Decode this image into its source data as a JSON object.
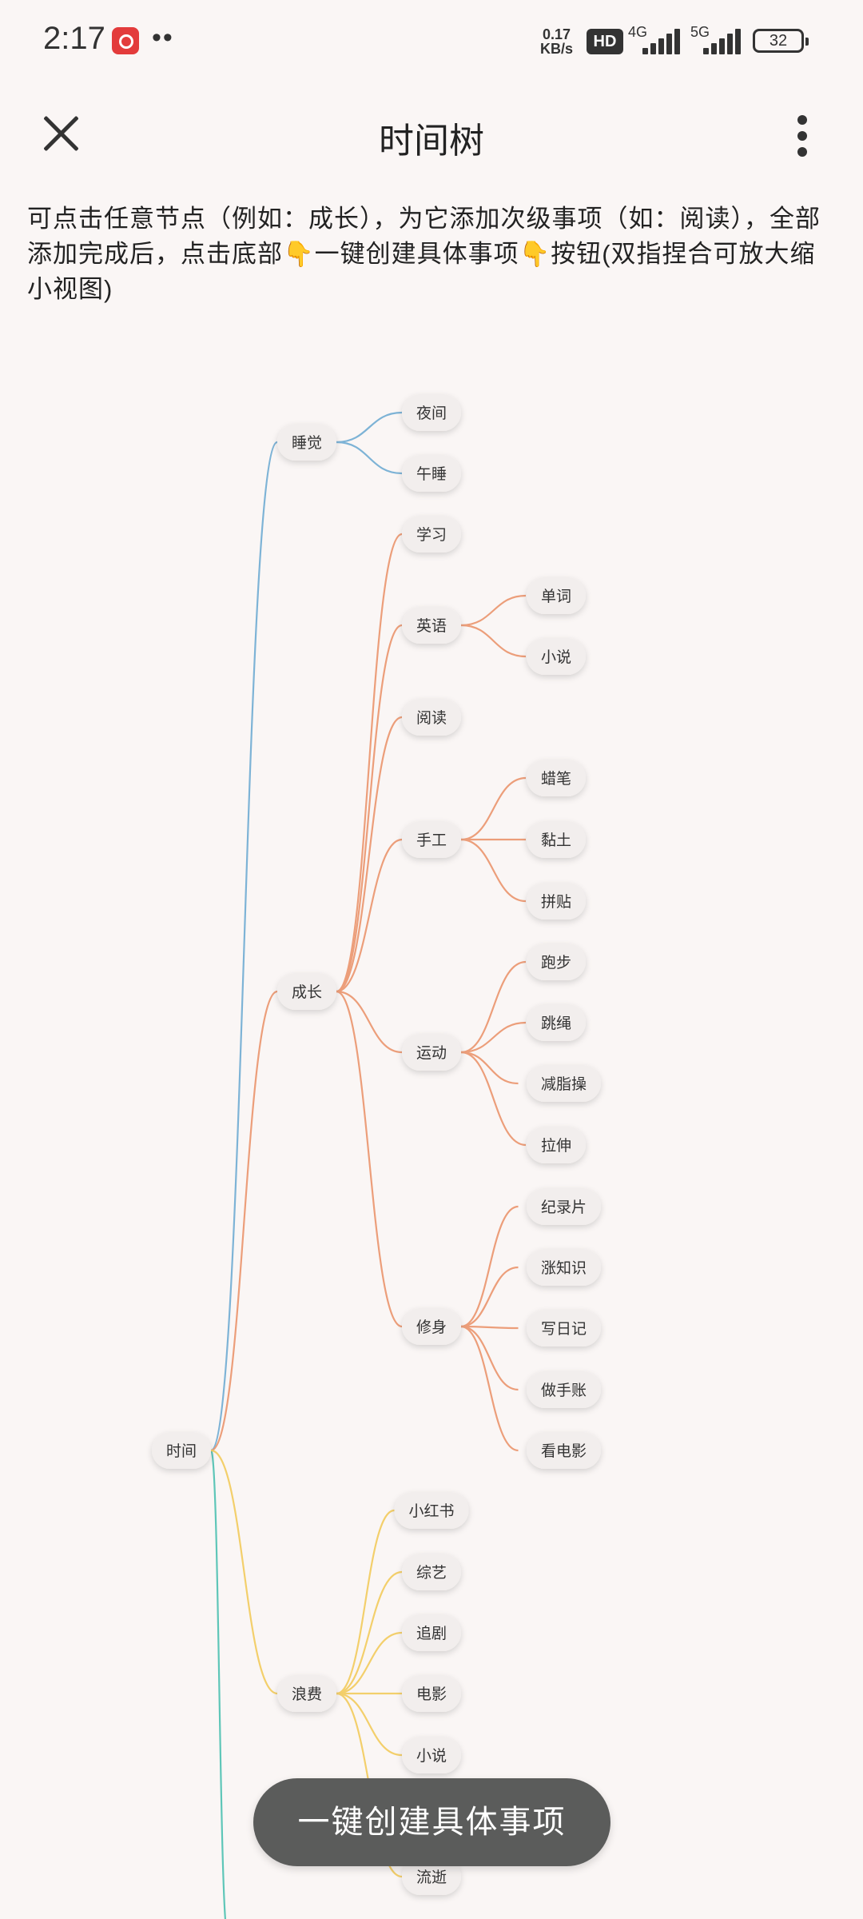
{
  "status_bar": {
    "time": "2:17",
    "dots": "••",
    "speed_value": "0.17",
    "speed_unit": "KB/s",
    "hd_label": "HD",
    "net1": "4G",
    "net2": "5G",
    "battery": "32",
    "app_icon": "netease-music-icon"
  },
  "header": {
    "title": "时间树",
    "close_icon": "close-icon",
    "more_icon": "more-vertical-icon"
  },
  "instruction": "可点击任意节点（例如：成长），为它添加次级事项（如：阅读），全部添加完成后，点击底部👇一键创建具体事项👇按钮(双指捏合可放大缩小视图)",
  "colors": {
    "sleep": "#7db3d6",
    "growth": "#ec9e7a",
    "waste": "#f3cf6b",
    "teal": "#5ec6b8"
  },
  "tree": {
    "root": "时间",
    "branches": [
      {
        "label": "睡觉",
        "children": [
          {
            "label": "夜间"
          },
          {
            "label": "午睡"
          }
        ]
      },
      {
        "label": "成长",
        "children": [
          {
            "label": "学习"
          },
          {
            "label": "英语",
            "children": [
              "单词",
              "小说"
            ]
          },
          {
            "label": "阅读"
          },
          {
            "label": "手工",
            "children": [
              "蜡笔",
              "黏土",
              "拼贴"
            ]
          },
          {
            "label": "运动",
            "children": [
              "跑步",
              "跳绳",
              "减脂操",
              "拉伸"
            ]
          },
          {
            "label": "修身",
            "children": [
              "纪录片",
              "涨知识",
              "写日记",
              "做手账",
              "看电影"
            ]
          }
        ]
      },
      {
        "label": "浪费",
        "children": [
          {
            "label": "小红书"
          },
          {
            "label": "综艺"
          },
          {
            "label": "追剧"
          },
          {
            "label": "电影"
          },
          {
            "label": "小说"
          },
          {
            "label": "流逝"
          }
        ]
      }
    ]
  },
  "cta_label": "一键创建具体事项"
}
